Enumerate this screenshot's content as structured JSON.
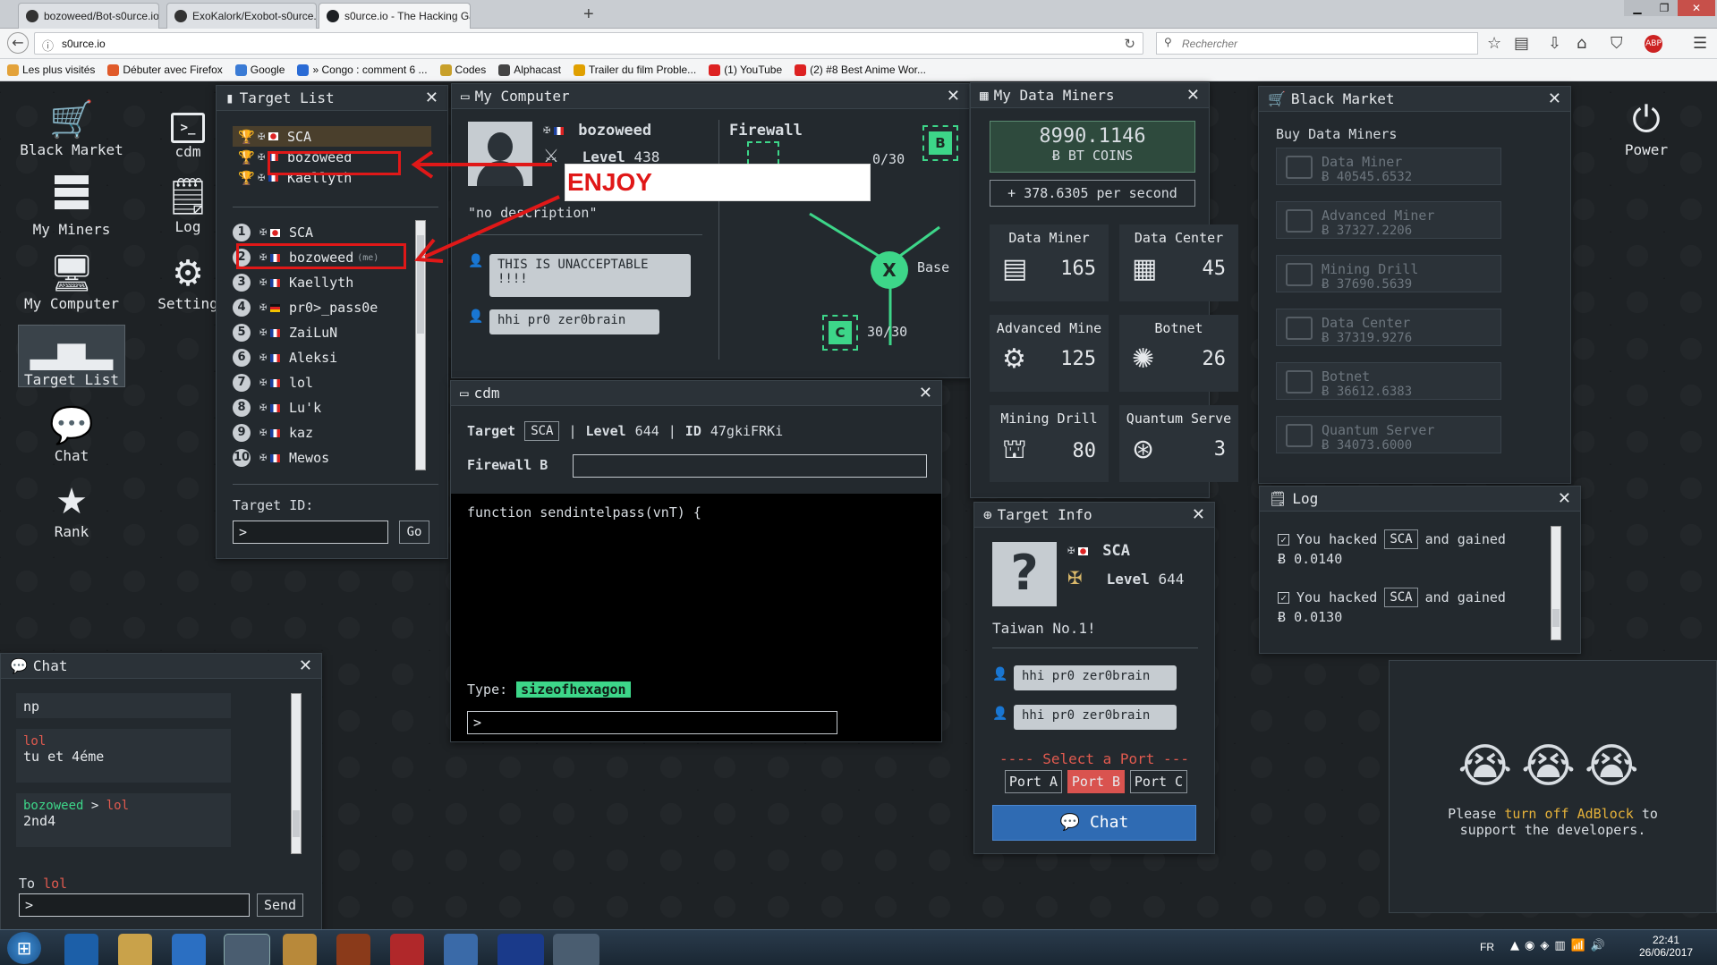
{
  "browser": {
    "tabs": [
      {
        "title": "bozoweed/Bot-s0urce.io: be"
      },
      {
        "title": "ExoKalork/Exobot-s0urce.io:"
      },
      {
        "title": "s0urce.io - The Hacking Gam"
      }
    ],
    "new_tab": "+",
    "url": "s0urce.io",
    "search_placeholder": "Rechercher",
    "bookmarks": [
      "Les plus visités",
      "Débuter avec Firefox",
      "Google",
      "» Congo : comment 6 ...",
      "Codes",
      "Alphacast",
      "Trailer du film Proble...",
      "(1) YouTube",
      "(2) #8 Best Anime Wor..."
    ]
  },
  "sidenav": {
    "left": [
      {
        "label": "Black Market",
        "icon": "cart-icon"
      },
      {
        "label": "cdm",
        "icon": "terminal-icon"
      },
      {
        "label": "My Miners",
        "icon": "server-icon"
      },
      {
        "label": "Log",
        "icon": "document-icon"
      },
      {
        "label": "My Computer",
        "icon": "monitor-icon"
      },
      {
        "label": "Setting",
        "icon": "gear-icon"
      },
      {
        "label": "Target List",
        "icon": "bar-chart-icon"
      },
      {
        "label": "Chat",
        "icon": "chat-icon"
      },
      {
        "label": "Rank",
        "icon": "star-icon"
      }
    ],
    "power": "Power"
  },
  "target_list": {
    "title": "Target List",
    "top": [
      "SCA",
      "bozoweed",
      "Kaellyth"
    ],
    "ranks": [
      {
        "n": "1",
        "name": "SCA"
      },
      {
        "n": "2",
        "name": "bozoweed",
        "tag": "(me)"
      },
      {
        "n": "3",
        "name": "Kaellyth"
      },
      {
        "n": "4",
        "name": "pr0>_pass0e"
      },
      {
        "n": "5",
        "name": "ZaiLuN"
      },
      {
        "n": "6",
        "name": "Aleksi"
      },
      {
        "n": "7",
        "name": "lol"
      },
      {
        "n": "8",
        "name": "Lu'k"
      },
      {
        "n": "9",
        "name": "kaz"
      },
      {
        "n": "10",
        "name": "Mewos"
      }
    ],
    "target_id_label": "Target ID:",
    "target_id_value": ">",
    "go": "Go"
  },
  "my_computer": {
    "title": "My Computer",
    "name": "bozoweed",
    "level_label": "Level",
    "level": "438",
    "description": "\"no description\"",
    "messages": [
      "THIS IS UNACCEPTABLE !!!!",
      "hhi pr0 zer0brain"
    ],
    "firewall_title": "Firewall",
    "fw_b": "0/30",
    "fw_c": "30/30",
    "base_label": "Base",
    "node_b": "B",
    "node_c": "C",
    "node_x": "X"
  },
  "overlay_text": "ENJOY",
  "cdm": {
    "title": "cdm",
    "target_label": "Target",
    "target": "SCA",
    "sep": "|",
    "level_label": "Level",
    "level": "644",
    "id_label": "ID",
    "id": "47gkiFRKi",
    "firewall_label": "Firewall B",
    "code": "function sendintelpass(vnT) {",
    "type_label": "Type:",
    "word": "sizeofhexagon",
    "input": ">"
  },
  "data_miners": {
    "title": "My Data Miners",
    "balance": "8990.1146",
    "unit": "BT COINS",
    "rate": "+ 378.6305 per second",
    "cells": [
      {
        "label": "Data Miner",
        "value": "165"
      },
      {
        "label": "Data Center",
        "value": "45"
      },
      {
        "label": "Advanced Mine",
        "value": "125"
      },
      {
        "label": "Botnet",
        "value": "26"
      },
      {
        "label": "Mining Drill",
        "value": "80"
      },
      {
        "label": "Quantum Serve",
        "value": "3"
      }
    ]
  },
  "black_market": {
    "title": "Black Market",
    "subtitle": "Buy Data Miners",
    "items": [
      {
        "name": "Data Miner",
        "price": "40545.6532"
      },
      {
        "name": "Advanced Miner",
        "price": "37327.2206"
      },
      {
        "name": "Mining Drill",
        "price": "37690.5639"
      },
      {
        "name": "Data Center",
        "price": "37319.9276"
      },
      {
        "name": "Botnet",
        "price": "36612.6383"
      },
      {
        "name": "Quantum Server",
        "price": "34073.6000"
      }
    ]
  },
  "log": {
    "title": "Log",
    "entries": [
      {
        "pre": "You hacked",
        "target": "SCA",
        "post": "and gained",
        "amount": "0.0140"
      },
      {
        "pre": "You hacked",
        "target": "SCA",
        "post": "and gained",
        "amount": "0.0130"
      }
    ]
  },
  "target_info": {
    "title": "Target Info",
    "name": "SCA",
    "level_label": "Level",
    "level": "644",
    "description": "Taiwan No.1!",
    "messages": [
      "hhi pr0 zer0brain",
      "hhi pr0 zer0brain"
    ],
    "select_port": "---- Select a Port ---",
    "ports": [
      "Port A",
      "Port B",
      "Port C"
    ],
    "chat": "Chat"
  },
  "chat": {
    "title": "Chat",
    "messages": [
      {
        "user": "",
        "text": "np"
      },
      {
        "user": "lol",
        "text": "tu et 4éme"
      },
      {
        "user": "bozoweed",
        "to": "lol",
        "text": "2nd4"
      }
    ],
    "to_label": "To",
    "to_user": "lol",
    "input": ">",
    "send": "Send"
  },
  "adblock": {
    "emoji": "😭",
    "line1": "Please",
    "link": "turn off AdBlock",
    "line1b": "to",
    "line2": "support the developers."
  },
  "taskbar": {
    "lang": "FR",
    "time": "22:41",
    "date": "26/06/2017"
  }
}
